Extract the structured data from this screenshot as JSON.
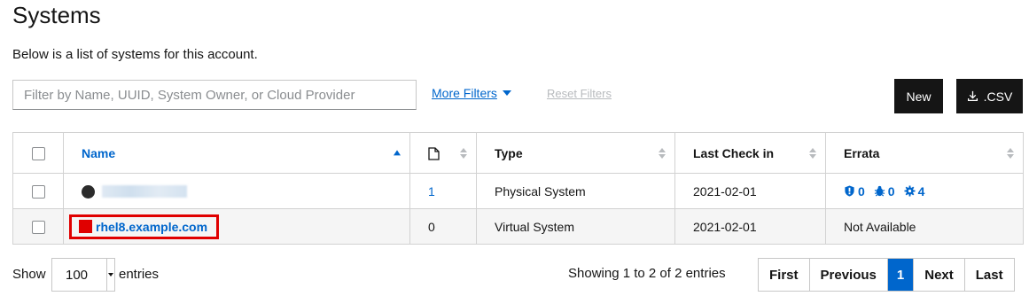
{
  "page": {
    "title": "Systems",
    "subtitle": "Below is a list of systems for this account."
  },
  "toolbar": {
    "filter_placeholder": "Filter by Name, UUID, System Owner, or Cloud Provider",
    "more_filters_label": "More Filters",
    "reset_filters_label": "Reset Filters",
    "new_label": "New",
    "csv_label": ".CSV"
  },
  "table": {
    "columns": {
      "name": "Name",
      "packages": "",
      "type": "Type",
      "last_check_in": "Last Check in",
      "errata": "Errata"
    },
    "rows": [
      {
        "name": "",
        "packages": "1",
        "type": "Physical System",
        "last_check_in": "2021-02-01",
        "errata_security": "0",
        "errata_bugfix": "0",
        "errata_enhancement": "4"
      },
      {
        "name": "rhel8.example.com",
        "packages": "0",
        "type": "Virtual System",
        "last_check_in": "2021-02-01",
        "errata_text": "Not Available"
      }
    ]
  },
  "footer": {
    "show_label": "Show",
    "entries_value": "100",
    "entries_label": "entries",
    "showing_text": "Showing 1 to 2 of 2 entries",
    "pagination": {
      "first": "First",
      "previous": "Previous",
      "current": "1",
      "next": "Next",
      "last": "Last"
    }
  },
  "colors": {
    "accent": "#0066cc",
    "highlight": "#e00000",
    "button_dark": "#151515"
  }
}
